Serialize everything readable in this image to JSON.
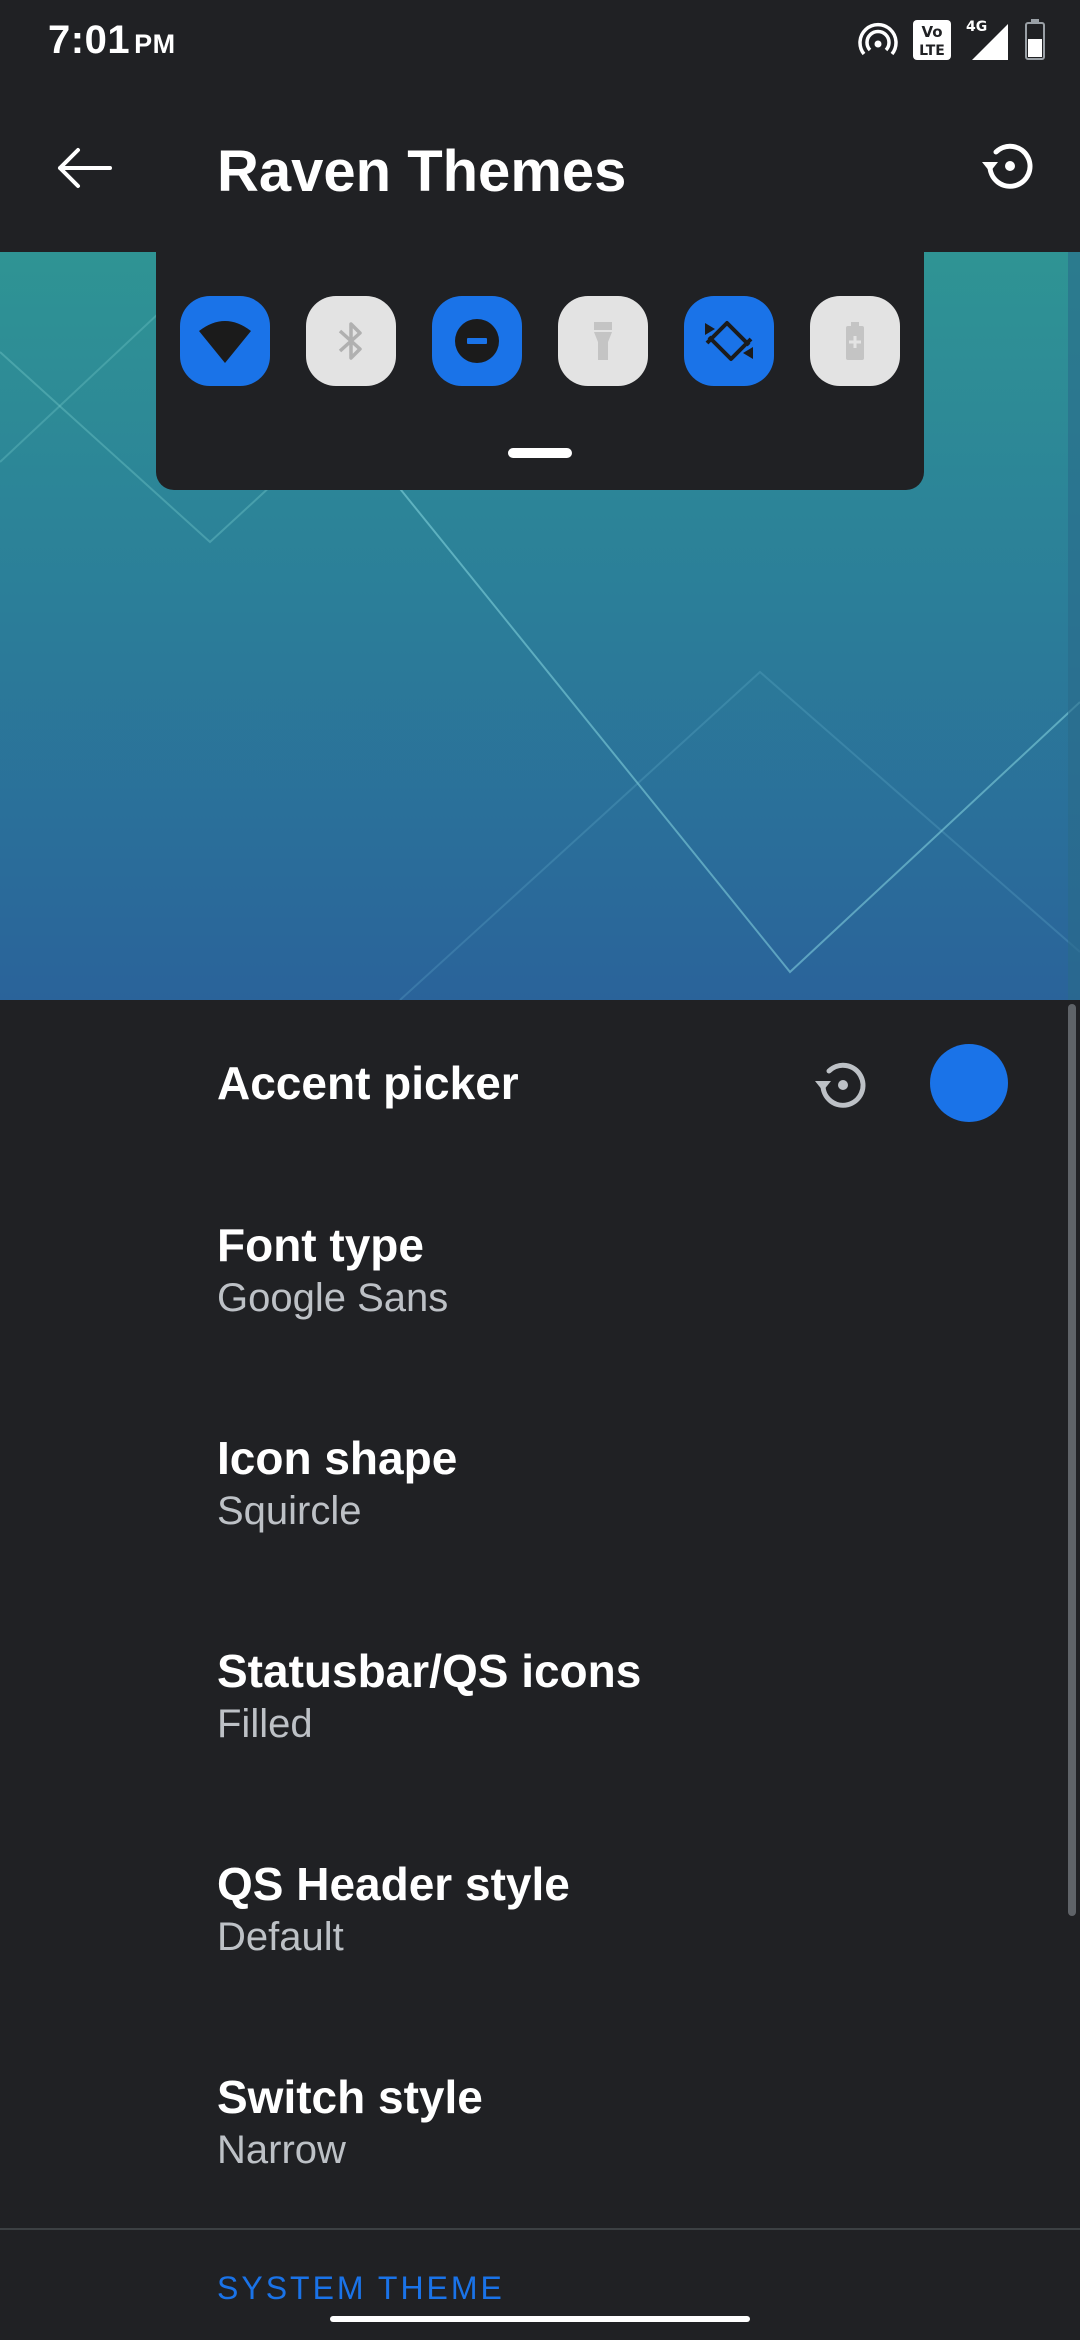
{
  "status_bar": {
    "time": "7:01",
    "ampm": "PM",
    "volte_label": "Vo LTE",
    "network_label": "4G"
  },
  "toolbar": {
    "title": "Raven Themes",
    "back_icon": "arrow-back-icon",
    "reset_icon": "restore-icon"
  },
  "preview": {
    "qs_tiles": [
      {
        "icon": "wifi-icon",
        "state": "on"
      },
      {
        "icon": "bluetooth-icon",
        "state": "off"
      },
      {
        "icon": "do-not-disturb-icon",
        "state": "on"
      },
      {
        "icon": "flashlight-icon",
        "state": "off"
      },
      {
        "icon": "auto-rotate-icon",
        "state": "on"
      },
      {
        "icon": "battery-saver-icon",
        "state": "off"
      }
    ]
  },
  "settings": {
    "accent_picker": {
      "title": "Accent picker",
      "color": "#1a73e8"
    },
    "font_type": {
      "title": "Font type",
      "value": "Google Sans"
    },
    "icon_shape": {
      "title": "Icon shape",
      "value": "Squircle"
    },
    "statusbar_icons": {
      "title": "Statusbar/QS icons",
      "value": "Filled"
    },
    "qs_header_style": {
      "title": "QS Header style",
      "value": "Default"
    },
    "switch_style": {
      "title": "Switch style",
      "value": "Narrow"
    }
  },
  "section": {
    "header": "SYSTEM THEME"
  },
  "colors": {
    "background": "#202124",
    "accent": "#1a73e8",
    "tile_off": "#e3e3e3",
    "secondary_text": "#bdc1c6"
  }
}
